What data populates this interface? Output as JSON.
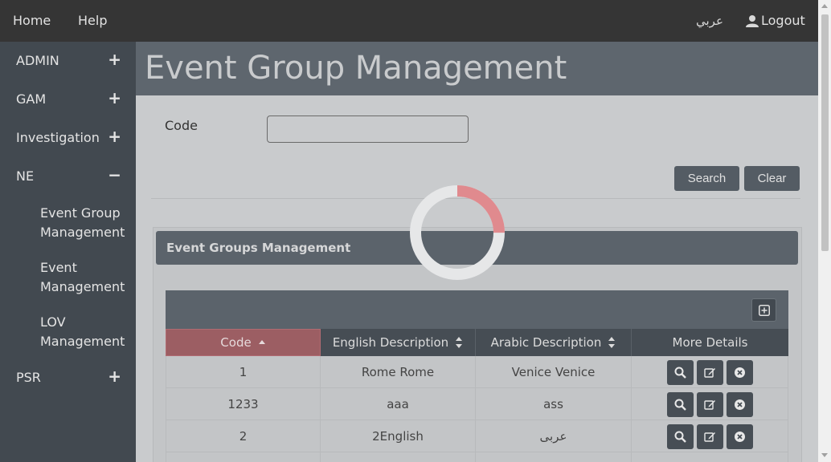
{
  "topbar": {
    "home": "Home",
    "help": "Help",
    "language": "عربي",
    "logout": "Logout"
  },
  "sidebar": {
    "items": [
      {
        "label": "ADMIN",
        "sign": "+"
      },
      {
        "label": "GAM",
        "sign": "+"
      },
      {
        "label": "Investigation",
        "sign": "+"
      },
      {
        "label": "NE",
        "sign": "−"
      },
      {
        "label": "PSR",
        "sign": "+"
      }
    ],
    "sub_items": [
      {
        "line1": "Event Group",
        "line2": "Management"
      },
      {
        "line1": "Event",
        "line2": "Management"
      },
      {
        "line1": "LOV",
        "line2": "Management"
      }
    ]
  },
  "page": {
    "title": "Event Group Management"
  },
  "search_form": {
    "code_label": "Code",
    "code_value": "",
    "search_label": "Search",
    "clear_label": "Clear"
  },
  "panel": {
    "title": "Event Groups Management"
  },
  "table": {
    "columns": [
      "Code",
      "English Description",
      "Arabic Description",
      "More Details"
    ],
    "rows": [
      {
        "code": "1",
        "english": "Rome Rome",
        "arabic": "Venice Venice"
      },
      {
        "code": "1233",
        "english": "aaa",
        "arabic": "ass"
      },
      {
        "code": "2",
        "english": "2English",
        "arabic": "عربى"
      }
    ]
  },
  "colors": {
    "topbar": "#353535",
    "sidebar": "#424950",
    "header": "#5e666e",
    "sorted_column": "#9c5e63",
    "spinner_accent": "#e08a8e"
  },
  "spinner": {
    "progress": 0.25
  }
}
